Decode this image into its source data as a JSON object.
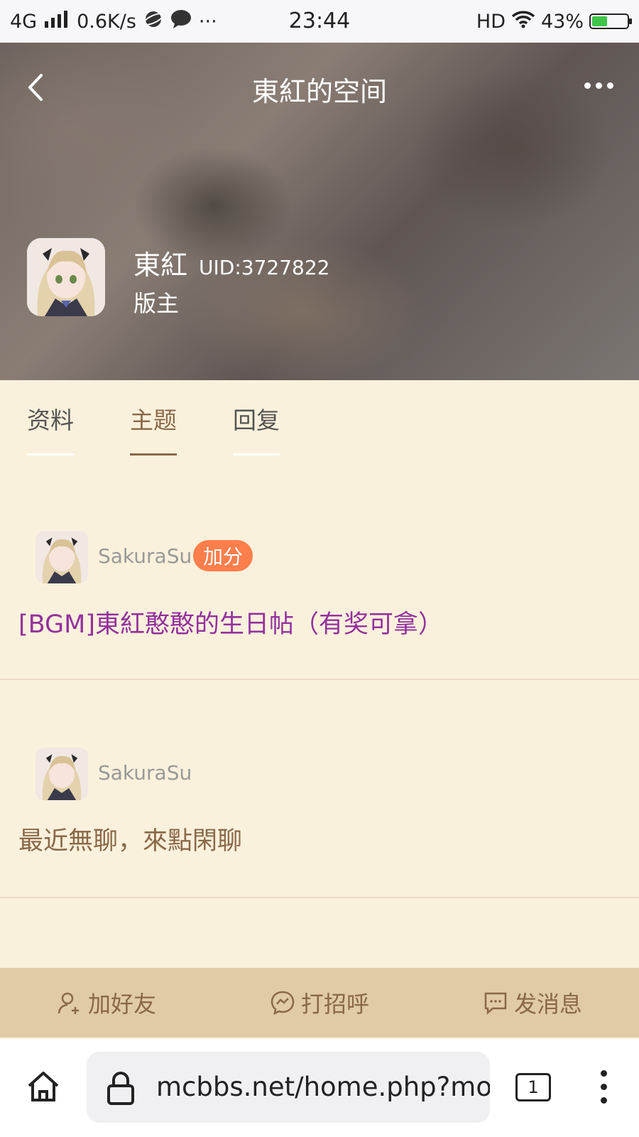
{
  "status_bar": {
    "network": "4G",
    "speed": "0.6K/s",
    "more": "···",
    "time": "23:44",
    "hd": "HD",
    "battery_percent": "43%",
    "battery_level": 0.43
  },
  "header": {
    "title": "東紅的空间"
  },
  "profile": {
    "name": "東紅",
    "uid": "UID:3727822",
    "role": "版主"
  },
  "tabs": [
    {
      "label": "资料",
      "active": false
    },
    {
      "label": "主题",
      "active": true
    },
    {
      "label": "回复",
      "active": false
    }
  ],
  "posts": [
    {
      "author": "SakuraSu",
      "badge": "加分",
      "title": "[BGM]東紅憨憨的生日帖（有奖可拿）"
    },
    {
      "author": "SakuraSu",
      "badge": "",
      "title": "最近無聊，來點閑聊"
    }
  ],
  "actions": {
    "add_friend": "加好友",
    "greet": "打招呼",
    "message": "发消息"
  },
  "browser": {
    "url": "mcbbs.net/home.php?mod=space",
    "tab_count": "1"
  },
  "colors": {
    "background": "#faf1dc",
    "accent_brown": "#8a6848",
    "title_purple": "#93319e",
    "badge_orange": "#fe7e4c",
    "action_bar": "#e0cba6"
  }
}
